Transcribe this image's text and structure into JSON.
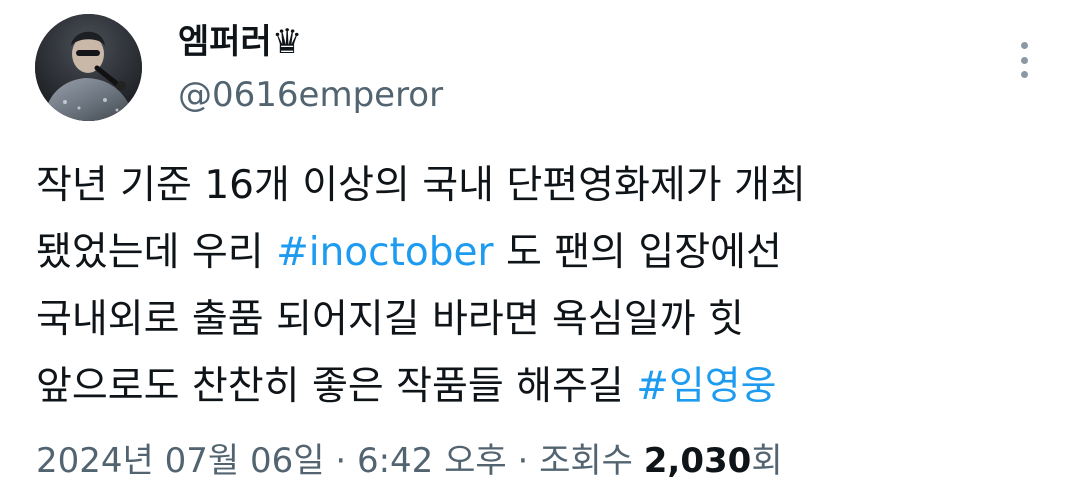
{
  "author": {
    "display_name": "엠퍼러♛",
    "handle": "@0616emperor",
    "avatar_icon": "profile-photo"
  },
  "more_icon": "more-vertical-icon",
  "tweet": {
    "lines": [
      [
        {
          "text": "작년 기준 16개 이상의 국내 단편영화제가 개최",
          "type": "text"
        }
      ],
      [
        {
          "text": "됐었는데 우리 ",
          "type": "text"
        },
        {
          "text": "#inoctober",
          "type": "hashtag"
        },
        {
          "text": " 도 팬의 입장에선",
          "type": "text"
        }
      ],
      [
        {
          "text": "국내외로 출품 되어지길 바라면 욕심일까 힛",
          "type": "text"
        }
      ],
      [
        {
          "text": "앞으로도 찬찬히 좋은 작품들 해주길 ",
          "type": "text"
        },
        {
          "text": "#임영웅",
          "type": "hashtag"
        }
      ]
    ]
  },
  "meta": {
    "date": "2024년 07월 06일",
    "separator": " · ",
    "time": "6:42 오후",
    "views_label": "조회수 ",
    "views_count": "2,030",
    "views_suffix": "회"
  },
  "colors": {
    "text": "#0f1419",
    "secondary": "#536471",
    "hashtag": "#1d9bf0",
    "background": "#ffffff"
  }
}
